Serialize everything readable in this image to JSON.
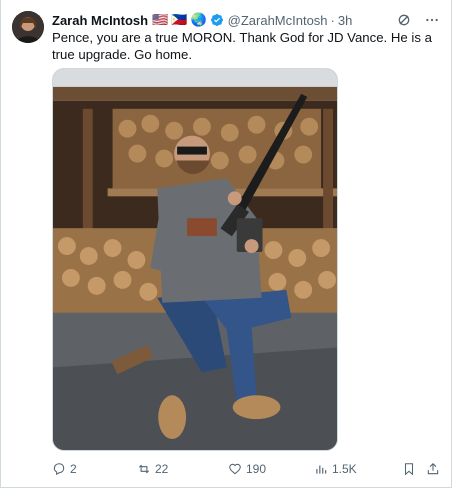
{
  "author": {
    "name": "Zarah McIntosh",
    "flags": [
      "🇺🇸",
      "🇵🇭"
    ],
    "globe": "🌏",
    "handle": "@ZarahMcIntosh",
    "separator": "·",
    "time": "3h",
    "verified_color": "#1d9bf0"
  },
  "tweet": {
    "text": "Pence, you are a true MORON. Thank God for JD Vance. He is a true upgrade. Go home."
  },
  "header_icons": [
    "grok-icon",
    "more-icon"
  ],
  "media": {
    "alt": "Man in sunglasses and hoodie sitting on a stool holding a rifle in front of stacked firewood"
  },
  "actions": {
    "replies": "2",
    "reposts": "22",
    "likes": "190",
    "views": "1.5K"
  },
  "colors": {
    "text": "#0f1419",
    "secondary": "#536471",
    "border": "#cfd9de",
    "accent": "#1d9bf0"
  }
}
